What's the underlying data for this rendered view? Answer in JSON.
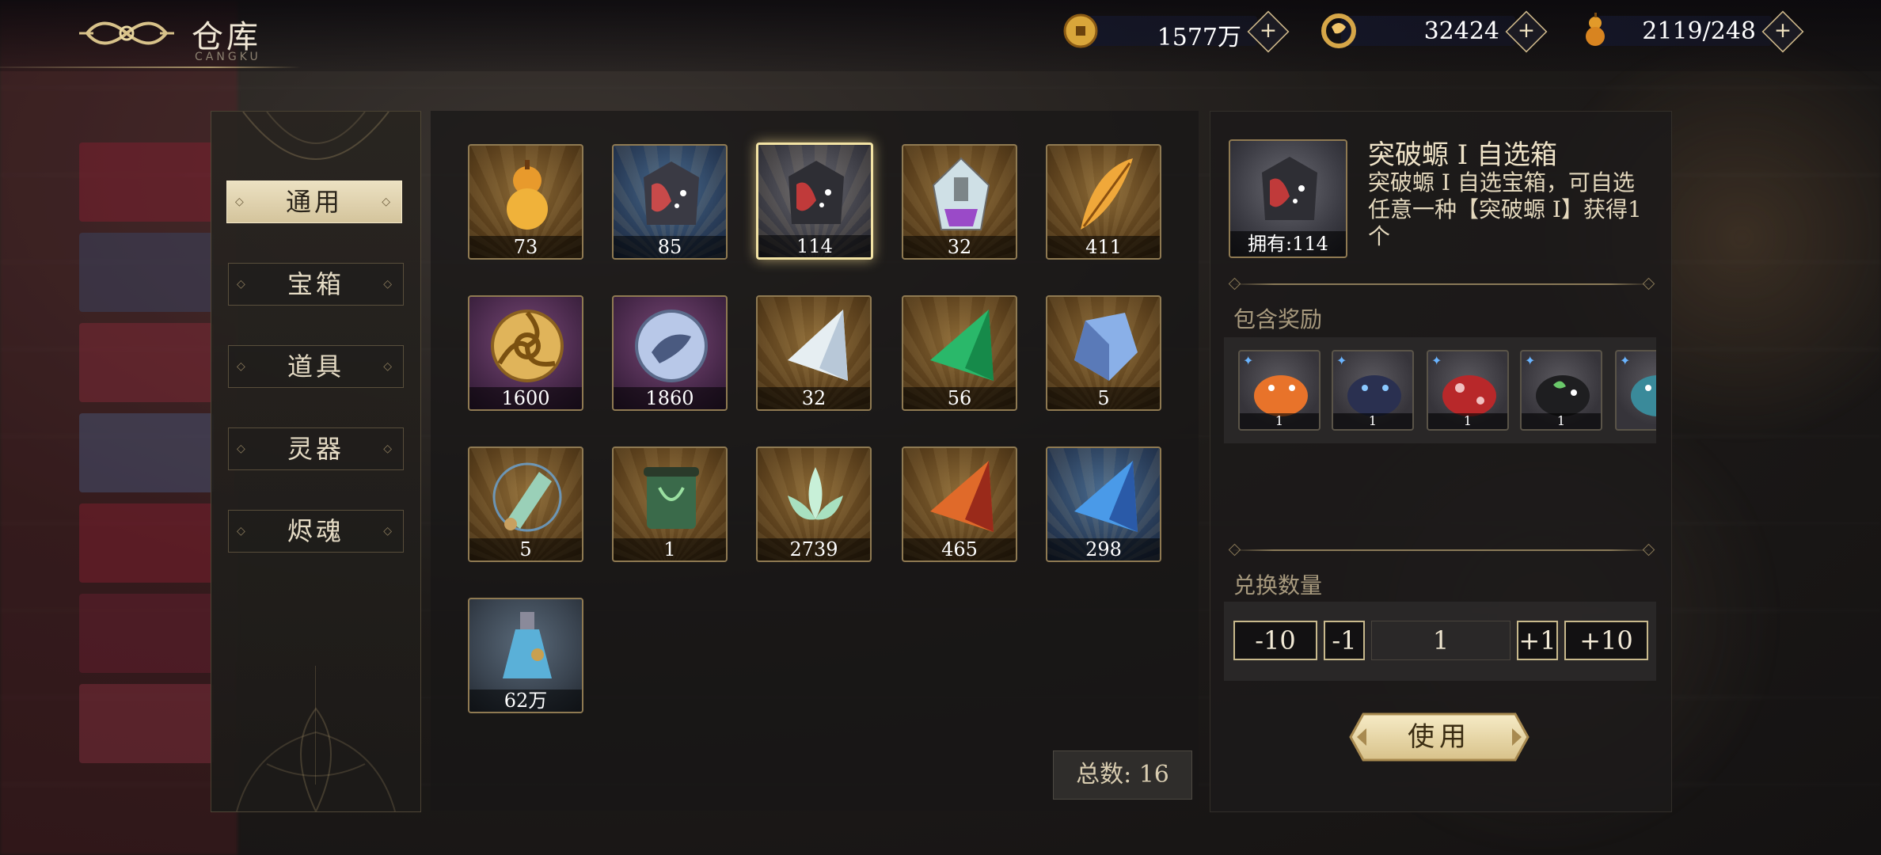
{
  "header": {
    "title": "仓库",
    "subtitle": "CANGKU",
    "currencies": [
      {
        "icon": "coin-icon",
        "value": "1577万"
      },
      {
        "icon": "dragon-token-icon",
        "value": "32424"
      },
      {
        "icon": "gourd-stamina-icon",
        "value": "2119/248"
      }
    ],
    "plus_symbol": "+"
  },
  "nav": {
    "items": [
      {
        "label": "通用",
        "active": true
      },
      {
        "label": "宝箱",
        "active": false
      },
      {
        "label": "道具",
        "active": false
      },
      {
        "label": "灵器",
        "active": false
      },
      {
        "label": "烬魂",
        "active": false
      }
    ]
  },
  "inventory": {
    "items": [
      {
        "icon": "orange-gourd-icon",
        "count": "73"
      },
      {
        "icon": "pheasant-chest-icon",
        "count": "85"
      },
      {
        "icon": "pheasant-chest-red-icon",
        "count": "114"
      },
      {
        "icon": "talisman-tag-icon",
        "count": "32"
      },
      {
        "icon": "golden-feather-icon",
        "count": "411"
      },
      {
        "icon": "golden-triskele-coin-icon",
        "count": "1600"
      },
      {
        "icon": "silver-beast-coin-icon",
        "count": "1860"
      },
      {
        "icon": "white-crystal-shard-icon",
        "count": "32"
      },
      {
        "icon": "green-crystal-shard-icon",
        "count": "56"
      },
      {
        "icon": "blue-crystal-ore-icon",
        "count": "5"
      },
      {
        "icon": "blue-scroll-icon",
        "count": "5"
      },
      {
        "icon": "green-scroll-icon",
        "count": "1"
      },
      {
        "icon": "jade-lotus-icon",
        "count": "2739"
      },
      {
        "icon": "red-crystal-shard-icon",
        "count": "465"
      },
      {
        "icon": "blue-crystal-shard-icon",
        "count": "298"
      },
      {
        "icon": "potion-bottle-icon",
        "count": "62万"
      }
    ],
    "total_label": "总数: 16"
  },
  "detail": {
    "name": "突破螈 I 自选箱",
    "own_label": "拥有:114",
    "description": "突破螈 I 自选宝箱，可自选任意一种【突破螈 I】获得1个",
    "rewards_label": "包含奖励",
    "rewards": [
      {
        "icon": "orange-salamander-icon",
        "count": "1"
      },
      {
        "icon": "navy-salamander-icon",
        "count": "1"
      },
      {
        "icon": "red-spotted-salamander-icon",
        "count": "1"
      },
      {
        "icon": "black-leaf-salamander-icon",
        "count": "1"
      },
      {
        "icon": "teal-salamander-icon",
        "count": ""
      }
    ],
    "quantity_label": "兑换数量",
    "quantity": {
      "minus10": "-10",
      "minus1": "-1",
      "value": "1",
      "plus1": "+1",
      "plus10": "+10"
    },
    "use_label": "使用"
  }
}
